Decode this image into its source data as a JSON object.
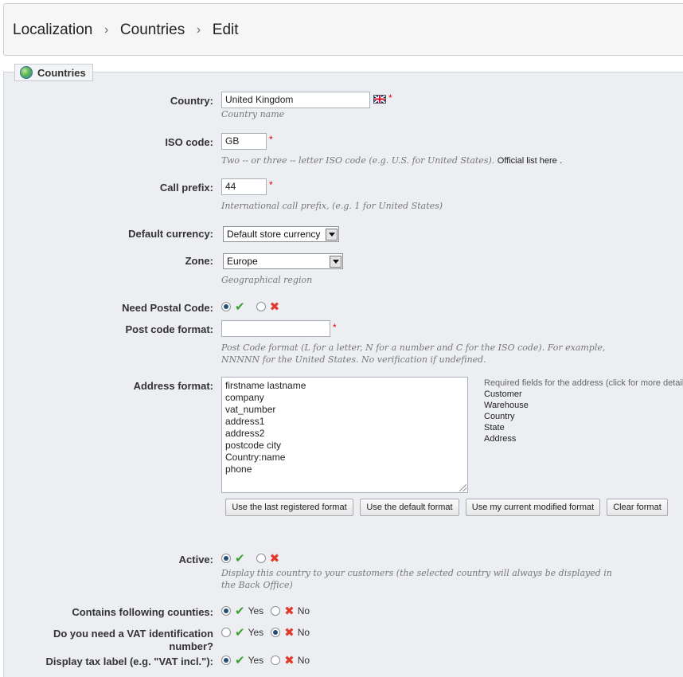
{
  "breadcrumb": {
    "items": [
      "Localization",
      "Countries",
      "Edit"
    ],
    "separator": "›"
  },
  "panel": {
    "legend": "Countries"
  },
  "colors": {
    "accent": "#234d7a",
    "required": "#dd0000",
    "yes": "#3aa030",
    "no": "#e03a2c"
  },
  "form": {
    "country": {
      "label": "Country:",
      "value": "United Kingdom",
      "hint": "Country name",
      "required": "*"
    },
    "iso_code": {
      "label": "ISO code:",
      "value": "GB",
      "required": "*",
      "hint": "Two -- or three -- letter ISO code (e.g. U.S. for United States).",
      "link": "Official list here",
      "hint_end": "."
    },
    "call_prefix": {
      "label": "Call prefix:",
      "value": "44",
      "required": "*",
      "hint": "International call prefix, (e.g. 1 for United States)"
    },
    "default_currency": {
      "label": "Default currency:",
      "selected": "Default store currency"
    },
    "zone": {
      "label": "Zone:",
      "selected": "Europe",
      "hint": "Geographical region"
    },
    "need_postal_code": {
      "label": "Need Postal Code:",
      "selected": "yes"
    },
    "post_code_format": {
      "label": "Post code format:",
      "value": "",
      "required": "*",
      "hint_line1": "Post Code format (L for a letter, N for a number and C for the ISO code). For example,",
      "hint_line2": "NNNNN for the United States. No verification if undefined."
    },
    "address_format": {
      "label": "Address format:",
      "lines": [
        "firstname lastname",
        "company",
        "vat_number",
        "address1",
        "address2",
        "postcode city",
        "Country:name",
        "phone"
      ],
      "required_title": "Required fields for the address (click for more detail",
      "required_fields": [
        "Customer",
        "Warehouse",
        "Country",
        "State",
        "Address"
      ],
      "buttons": [
        "Use the last registered format",
        "Use the default format",
        "Use my current modified format",
        "Clear format"
      ]
    },
    "active": {
      "label": "Active:",
      "selected": "yes",
      "hint_line1": "Display this country to your customers (the selected country will always be displayed in",
      "hint_line2": "the Back Office)"
    },
    "contains_counties": {
      "label": "Contains following counties:",
      "yes": "Yes",
      "no": "No",
      "selected": "yes"
    },
    "need_vat": {
      "label": "Do you need a VAT identification number?",
      "yes": "Yes",
      "no": "No",
      "selected": "no"
    },
    "display_tax_label": {
      "label": "Display tax label (e.g. \"VAT incl.\"):",
      "yes": "Yes",
      "no": "No",
      "selected": "yes"
    }
  }
}
